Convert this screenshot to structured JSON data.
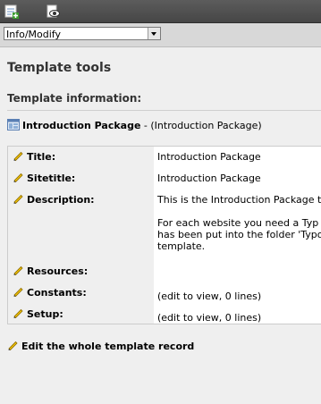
{
  "toolbar": {
    "new_icon": "new-record-icon",
    "view_icon": "view-webpage-icon"
  },
  "function_menu": {
    "selected": "Info/Modify"
  },
  "page": {
    "title": "Template tools",
    "section_title": "Template information:"
  },
  "template": {
    "name": "Introduction Package",
    "subtitle": " - (Introduction Package)"
  },
  "rows": [
    {
      "label": "Title:",
      "value": "Introduction Package"
    },
    {
      "label": "Sitetitle:",
      "value": "Introduction Package"
    },
    {
      "label": "Description:",
      "value_lines": [
        "This is the Introduction Package t",
        "",
        "For each website you need a Typ",
        "has been put into the folder 'Typo",
        "template."
      ]
    },
    {
      "label": "Resources:",
      "value": ""
    },
    {
      "label": "Constants:",
      "value": "(edit to view, 0 lines)"
    },
    {
      "label": "Setup:",
      "value": "(edit to view, 0 lines)"
    }
  ],
  "edit_whole": "Edit the whole template record",
  "colors": {
    "topbar": "#4f4f4f",
    "background": "#efefef",
    "pencil": "#e8b400"
  }
}
